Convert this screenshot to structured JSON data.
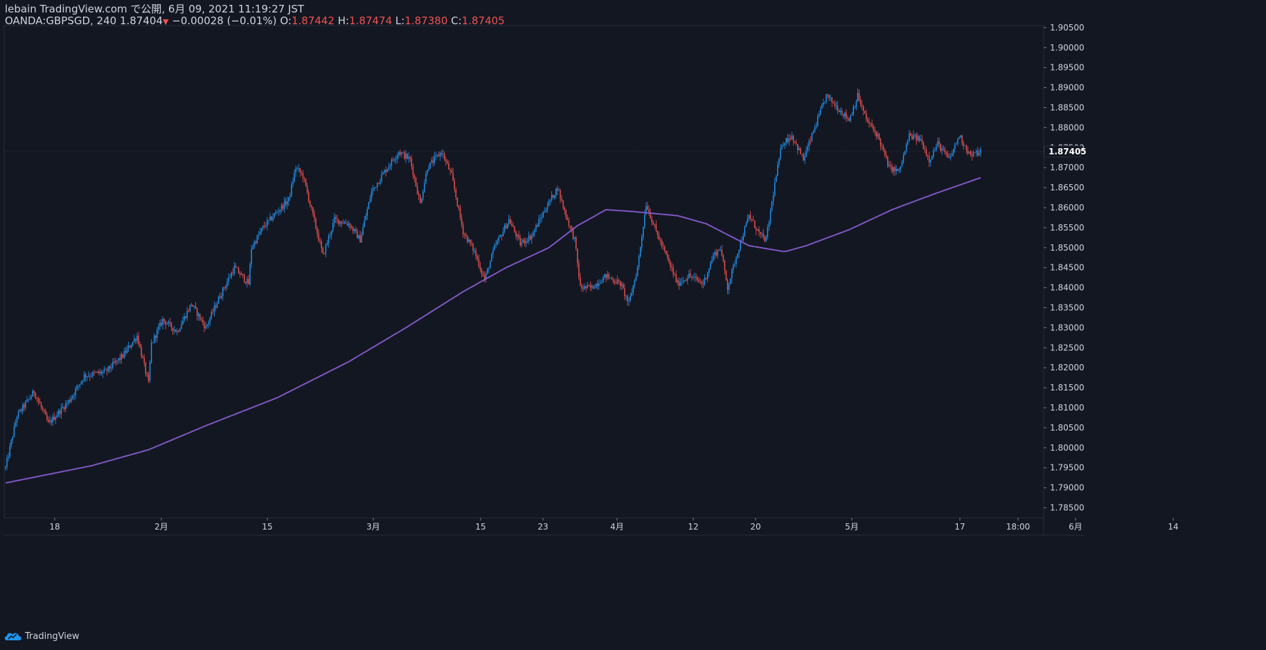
{
  "header": {
    "line1": "lebain TradingView.com で公開, 6月 09, 2021 11:19:27 JST",
    "symbol": "OANDA:GBPSGD, 240",
    "last": "1.87404",
    "change": "−0.00028 (−0.01%)",
    "open_label": "O:",
    "open": "1.87442",
    "high_label": "H:",
    "high": "1.87474",
    "low_label": "L:",
    "low": "1.87380",
    "close_label": "C:",
    "close": "1.87405"
  },
  "footer": {
    "brand": "TradingView"
  },
  "colors": {
    "background": "#131722",
    "up": "#2196f3",
    "down": "#ef5350",
    "ma": "#7e57c2",
    "axis_text": "#d1d4dc"
  },
  "chart_data": {
    "type": "candlestick",
    "y_ticks": [
      "1.90500",
      "1.90000",
      "1.89500",
      "1.89000",
      "1.88500",
      "1.88000",
      "1.87500",
      "1.87000",
      "1.86500",
      "1.86000",
      "1.85500",
      "1.85000",
      "1.84500",
      "1.84000",
      "1.83500",
      "1.83000",
      "1.82500",
      "1.82000",
      "1.81500",
      "1.81000",
      "1.80500",
      "1.80000",
      "1.79500",
      "1.79000",
      "1.78500"
    ],
    "ylim": [
      1.7825,
      1.9055
    ],
    "last_price_label": "1.87405",
    "x_ticks": [
      "18",
      "2月",
      "15",
      "3月",
      "15",
      "23",
      "4月",
      "12",
      "20",
      "5月",
      "17",
      "18:00",
      "6月",
      "14"
    ],
    "price_path": [
      [
        0,
        1.795
      ],
      [
        8,
        1.808
      ],
      [
        20,
        1.814
      ],
      [
        30,
        1.806
      ],
      [
        45,
        1.812
      ],
      [
        55,
        1.818
      ],
      [
        70,
        1.819
      ],
      [
        82,
        1.823
      ],
      [
        92,
        1.828
      ],
      [
        100,
        1.816
      ],
      [
        102,
        1.826
      ],
      [
        110,
        1.832
      ],
      [
        120,
        1.829
      ],
      [
        130,
        1.836
      ],
      [
        140,
        1.83
      ],
      [
        150,
        1.838
      ],
      [
        160,
        1.845
      ],
      [
        170,
        1.841
      ],
      [
        172,
        1.85
      ],
      [
        180,
        1.855
      ],
      [
        190,
        1.859
      ],
      [
        198,
        1.862
      ],
      [
        203,
        1.87
      ],
      [
        208,
        1.868
      ],
      [
        215,
        1.858
      ],
      [
        222,
        1.848
      ],
      [
        230,
        1.857
      ],
      [
        240,
        1.856
      ],
      [
        248,
        1.852
      ],
      [
        256,
        1.864
      ],
      [
        265,
        1.869
      ],
      [
        275,
        1.874
      ],
      [
        283,
        1.872
      ],
      [
        290,
        1.861
      ],
      [
        295,
        1.87
      ],
      [
        305,
        1.874
      ],
      [
        312,
        1.868
      ],
      [
        320,
        1.854
      ],
      [
        328,
        1.849
      ],
      [
        335,
        1.842
      ],
      [
        342,
        1.85
      ],
      [
        352,
        1.857
      ],
      [
        360,
        1.851
      ],
      [
        368,
        1.853
      ],
      [
        378,
        1.86
      ],
      [
        386,
        1.865
      ],
      [
        392,
        1.858
      ],
      [
        398,
        1.852
      ],
      [
        402,
        1.84
      ],
      [
        410,
        1.84
      ],
      [
        420,
        1.843
      ],
      [
        430,
        1.841
      ],
      [
        436,
        1.836
      ],
      [
        442,
        1.845
      ],
      [
        448,
        1.861
      ],
      [
        455,
        1.854
      ],
      [
        462,
        1.848
      ],
      [
        470,
        1.841
      ],
      [
        478,
        1.843
      ],
      [
        488,
        1.841
      ],
      [
        495,
        1.848
      ],
      [
        500,
        1.85
      ],
      [
        505,
        1.84
      ],
      [
        512,
        1.849
      ],
      [
        520,
        1.858
      ],
      [
        528,
        1.853
      ],
      [
        532,
        1.852
      ],
      [
        538,
        1.866
      ],
      [
        543,
        1.876
      ],
      [
        550,
        1.878
      ],
      [
        558,
        1.872
      ],
      [
        566,
        1.88
      ],
      [
        574,
        1.888
      ],
      [
        582,
        1.885
      ],
      [
        590,
        1.882
      ],
      [
        596,
        1.888
      ],
      [
        602,
        1.882
      ],
      [
        610,
        1.878
      ],
      [
        618,
        1.87
      ],
      [
        625,
        1.869
      ],
      [
        632,
        1.878
      ],
      [
        640,
        1.877
      ],
      [
        646,
        1.872
      ],
      [
        652,
        1.876
      ],
      [
        660,
        1.872
      ],
      [
        667,
        1.878
      ],
      [
        675,
        1.873
      ],
      [
        682,
        1.874
      ]
    ],
    "ma_path": [
      [
        0,
        1.7912
      ],
      [
        60,
        1.7955
      ],
      [
        100,
        1.7995
      ],
      [
        140,
        1.8055
      ],
      [
        190,
        1.8125
      ],
      [
        240,
        1.8215
      ],
      [
        280,
        1.83
      ],
      [
        320,
        1.839
      ],
      [
        350,
        1.845
      ],
      [
        380,
        1.85
      ],
      [
        400,
        1.8555
      ],
      [
        420,
        1.8595
      ],
      [
        440,
        1.859
      ],
      [
        470,
        1.858
      ],
      [
        490,
        1.856
      ],
      [
        520,
        1.8505
      ],
      [
        545,
        1.849
      ],
      [
        560,
        1.8505
      ],
      [
        590,
        1.8545
      ],
      [
        620,
        1.8595
      ],
      [
        650,
        1.8635
      ],
      [
        682,
        1.8675
      ]
    ],
    "bar_count": 683,
    "moving_average": true,
    "grid": false
  }
}
